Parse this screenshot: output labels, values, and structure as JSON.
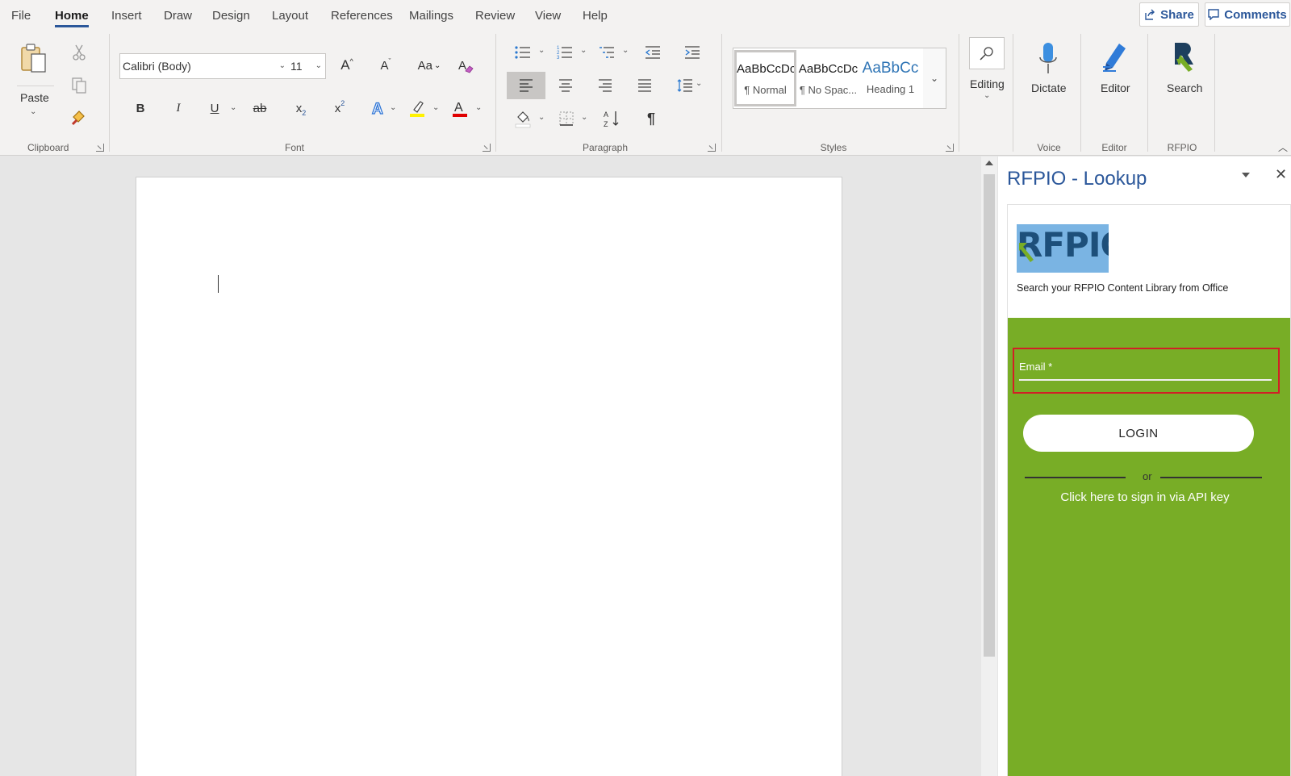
{
  "menu": {
    "tabs": [
      "File",
      "Home",
      "Insert",
      "Draw",
      "Design",
      "Layout",
      "References",
      "Mailings",
      "Review",
      "View",
      "Help"
    ],
    "active_tab": "Home",
    "share_label": "Share",
    "comments_label": "Comments"
  },
  "ribbon": {
    "clipboard": {
      "paste_label": "Paste",
      "group_label": "Clipboard"
    },
    "font": {
      "font_name": "Calibri (Body)",
      "font_size": "11",
      "grow_label": "A",
      "shrink_label": "A",
      "case_label": "Aa",
      "bold_label": "B",
      "italic_label": "I",
      "underline_label": "U",
      "strike_label": "ab",
      "subscript_label": "x",
      "superscript_label": "x",
      "group_label": "Font"
    },
    "paragraph": {
      "pilcrow": "¶",
      "group_label": "Paragraph"
    },
    "styles": {
      "items": [
        {
          "sample": "AaBbCcDc",
          "name": "¶ Normal"
        },
        {
          "sample": "AaBbCcDc",
          "name": "¶ No Spac..."
        },
        {
          "sample": "AaBbCc",
          "name": "Heading 1"
        }
      ],
      "group_label": "Styles"
    },
    "editing": {
      "label": "Editing"
    },
    "voice": {
      "dictate_label": "Dictate",
      "group_label": "Voice"
    },
    "editor": {
      "label": "Editor",
      "group_label": "Editor"
    },
    "rfpio": {
      "search_label": "Search",
      "group_label": "RFPIO"
    }
  },
  "taskpane": {
    "title": "RFPIO - Lookup",
    "logo_text": "RFPIO",
    "tagline": "Search your RFPIO Content Library from Office",
    "email_label": "Email *",
    "login_label": "LOGIN",
    "or_text": "or",
    "api_link": "Click here to sign in via API key"
  },
  "colors": {
    "accent": "#2b579a",
    "pane_green": "#78ad26",
    "focus_border": "#d21f26",
    "highlight_yellow": "#fff200",
    "font_color_red": "#e00000"
  }
}
